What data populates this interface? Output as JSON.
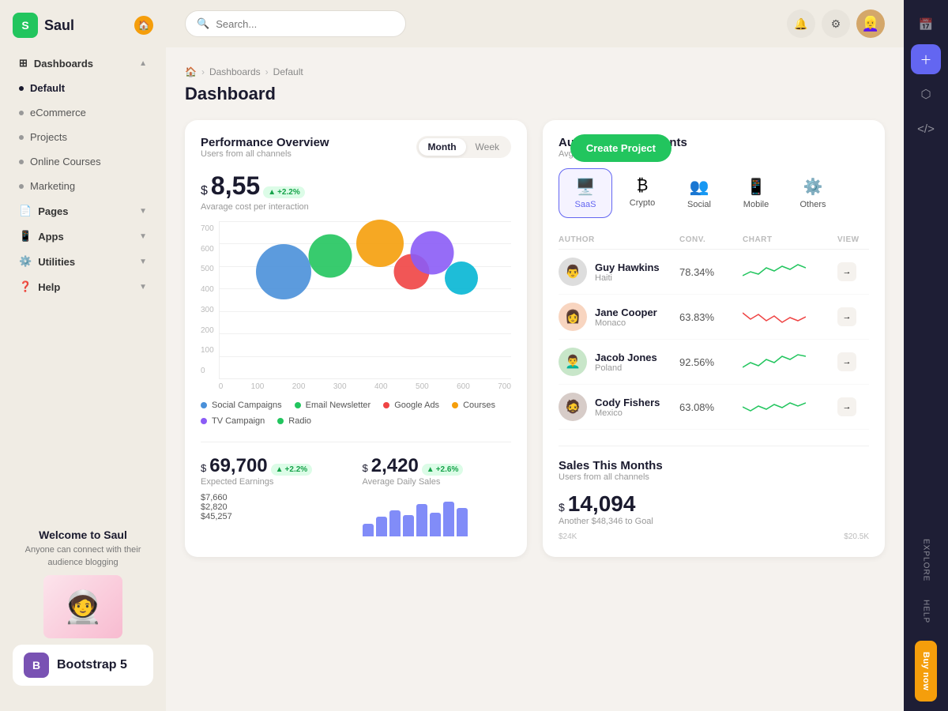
{
  "app": {
    "name": "Saul",
    "logo_letter": "S"
  },
  "sidebar": {
    "items": [
      {
        "id": "dashboards",
        "label": "Dashboards",
        "type": "group",
        "hasChevron": true,
        "icon": "⊞"
      },
      {
        "id": "default",
        "label": "Default",
        "type": "sub",
        "active": true
      },
      {
        "id": "ecommerce",
        "label": "eCommerce",
        "type": "sub"
      },
      {
        "id": "projects",
        "label": "Projects",
        "type": "sub"
      },
      {
        "id": "online-courses",
        "label": "Online Courses",
        "type": "sub"
      },
      {
        "id": "marketing",
        "label": "Marketing",
        "type": "sub"
      },
      {
        "id": "pages",
        "label": "Pages",
        "type": "group",
        "hasChevron": true,
        "icon": "📄"
      },
      {
        "id": "apps",
        "label": "Apps",
        "type": "group",
        "hasChevron": true,
        "icon": "📱"
      },
      {
        "id": "utilities",
        "label": "Utilities",
        "type": "group",
        "hasChevron": true,
        "icon": "⚙️"
      },
      {
        "id": "help",
        "label": "Help",
        "type": "group",
        "hasChevron": true,
        "icon": "❓"
      }
    ],
    "welcome": {
      "title": "Welcome to Saul",
      "subtitle": "Anyone can connect with their audience blogging"
    }
  },
  "header": {
    "search_placeholder": "Search...",
    "create_btn": "Create Project"
  },
  "breadcrumb": {
    "home": "🏠",
    "dashboards": "Dashboards",
    "current": "Default"
  },
  "page_title": "Dashboard",
  "performance": {
    "title": "Performance Overview",
    "subtitle": "Users from all channels",
    "tabs": [
      "Month",
      "Week"
    ],
    "active_tab": "Month",
    "value": "8,55",
    "badge": "+2.2%",
    "label": "Avarage cost per interaction",
    "y_labels": [
      "700",
      "600",
      "500",
      "400",
      "300",
      "200",
      "100",
      "0"
    ],
    "x_labels": [
      "0",
      "100",
      "200",
      "300",
      "400",
      "500",
      "600",
      "700"
    ],
    "bubbles": [
      {
        "x": 27,
        "y": 40,
        "size": 70,
        "color": "#4a90d9"
      },
      {
        "x": 44,
        "y": 30,
        "size": 55,
        "color": "#22c55e"
      },
      {
        "x": 58,
        "y": 22,
        "size": 60,
        "color": "#f59e0b"
      },
      {
        "x": 67,
        "y": 40,
        "size": 45,
        "color": "#ef4444"
      },
      {
        "x": 72,
        "y": 30,
        "size": 50,
        "color": "#8b5cf6"
      },
      {
        "x": 81,
        "y": 42,
        "size": 40,
        "color": "#06b6d4"
      }
    ],
    "legend": [
      {
        "label": "Social Campaigns",
        "color": "#4a90d9"
      },
      {
        "label": "Email Newsletter",
        "color": "#22c55e"
      },
      {
        "label": "Google Ads",
        "color": "#ef4444"
      },
      {
        "label": "Courses",
        "color": "#f59e0b"
      },
      {
        "label": "TV Campaign",
        "color": "#8b5cf6"
      },
      {
        "label": "Radio",
        "color": "#22c55e"
      }
    ]
  },
  "authors": {
    "title": "Authors Achievements",
    "subtitle": "Avg. 69.34% Conv. Rate",
    "tabs": [
      {
        "id": "saas",
        "label": "SaaS",
        "icon": "🖥️",
        "active": true
      },
      {
        "id": "crypto",
        "label": "Crypto",
        "icon": "₿"
      },
      {
        "id": "social",
        "label": "Social",
        "icon": "👥"
      },
      {
        "id": "mobile",
        "label": "Mobile",
        "icon": "📱"
      },
      {
        "id": "others",
        "label": "Others",
        "icon": "⚙️"
      }
    ],
    "columns": [
      "AUTHOR",
      "CONV.",
      "CHART",
      "VIEW"
    ],
    "rows": [
      {
        "name": "Guy Hawkins",
        "country": "Haiti",
        "conv": "78.34%",
        "chart_color": "#22c55e",
        "avatar": "👨"
      },
      {
        "name": "Jane Cooper",
        "country": "Monaco",
        "conv": "63.83%",
        "chart_color": "#ef4444",
        "avatar": "👩"
      },
      {
        "name": "Jacob Jones",
        "country": "Poland",
        "conv": "92.56%",
        "chart_color": "#22c55e",
        "avatar": "👨‍🦱"
      },
      {
        "name": "Cody Fishers",
        "country": "Mexico",
        "conv": "63.08%",
        "chart_color": "#22c55e",
        "avatar": "🧔"
      }
    ]
  },
  "earnings": {
    "value": "69,700",
    "badge": "+2.2%",
    "label": "Expected Earnings",
    "items": [
      "$7,660",
      "$2,820",
      "$45,257"
    ]
  },
  "daily_sales": {
    "value": "2,420",
    "badge": "+2.6%",
    "label": "Average Daily Sales",
    "bars": [
      50,
      65,
      80,
      70,
      90,
      75,
      85,
      60
    ]
  },
  "sales_month": {
    "title": "Sales This Months",
    "subtitle": "Users from all channels",
    "value": "14,094",
    "goal_text": "Another $48,346 to Goal",
    "y1": "$24K",
    "y2": "$20.5K"
  },
  "right_bar": {
    "icons": [
      "📅",
      "+",
      "⬡",
      "</>"
    ],
    "tabs": [
      "Explore",
      "Help",
      "Buy now"
    ]
  }
}
